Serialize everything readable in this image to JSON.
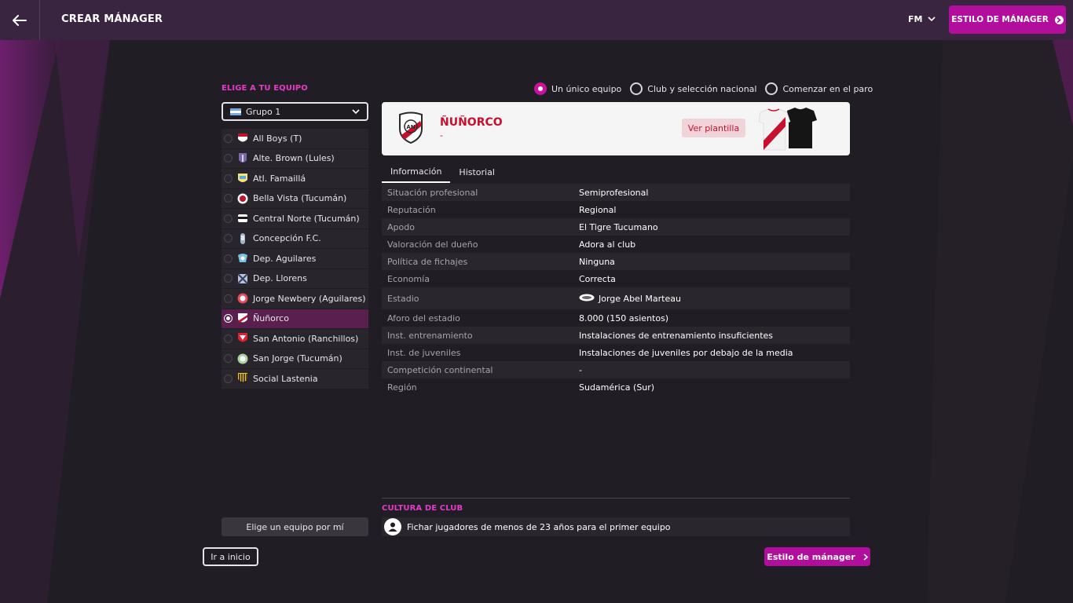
{
  "header": {
    "title": "CREAR MÁNAGER",
    "menu_label": "FM",
    "cta_label": "ESTILO DE MÁNAGER"
  },
  "team_picker": {
    "heading": "ELIGE A TU EQUIPO",
    "group_select": {
      "value": "Grupo 1",
      "flag": "argentina-flag-icon"
    },
    "teams": [
      {
        "name": "All Boys (T)",
        "icon": "all-boys-crest-icon",
        "selected": false
      },
      {
        "name": "Alte. Brown (Lules)",
        "icon": "alte-brown-crest-icon",
        "selected": false
      },
      {
        "name": "Atl. Famaillá",
        "icon": "atl-famailla-crest-icon",
        "selected": false
      },
      {
        "name": "Bella Vista (Tucumán)",
        "icon": "bella-vista-crest-icon",
        "selected": false
      },
      {
        "name": "Central Norte (Tucumán)",
        "icon": "central-norte-crest-icon",
        "selected": false
      },
      {
        "name": "Concepción F.C.",
        "icon": "concepcion-crest-icon",
        "selected": false
      },
      {
        "name": "Dep. Aguilares",
        "icon": "dep-aguilares-crest-icon",
        "selected": false
      },
      {
        "name": "Dep. Llorens",
        "icon": "dep-llorens-crest-icon",
        "selected": false
      },
      {
        "name": "Jorge Newbery (Aguilares)",
        "icon": "jorge-newbery-crest-icon",
        "selected": false
      },
      {
        "name": "Ñuñorco",
        "icon": "nunorco-crest-icon",
        "selected": true
      },
      {
        "name": "San Antonio (Ranchillos)",
        "icon": "san-antonio-crest-icon",
        "selected": false
      },
      {
        "name": "San Jorge (Tucumán)",
        "icon": "san-jorge-crest-icon",
        "selected": false
      },
      {
        "name": "Social Lastenia",
        "icon": "social-lastenia-crest-icon",
        "selected": false
      }
    ],
    "random_button": "Elige un equipo por mí",
    "home_button": "Ir a inicio"
  },
  "mode_options": [
    {
      "label": "Un único equipo",
      "selected": true
    },
    {
      "label": "Club y selección nacional",
      "selected": false
    },
    {
      "label": "Comenzar en el paro",
      "selected": false
    }
  ],
  "team_card": {
    "name": "ÑUÑORCO",
    "subtitle": "-",
    "squad_button": "Ver plantilla",
    "accent_color": "#c7102e"
  },
  "tabs": [
    {
      "label": "Información",
      "active": true
    },
    {
      "label": "Historial",
      "active": false
    }
  ],
  "info_rows": [
    {
      "label": "Situación profesional",
      "value": "Semiprofesional"
    },
    {
      "label": "Reputación",
      "value": "Regional"
    },
    {
      "label": "Apodo",
      "value": "El Tigre Tucumano"
    },
    {
      "label": "Valoración del dueño",
      "value": "Adora al club"
    },
    {
      "label": "Política de fichajes",
      "value": "Ninguna"
    },
    {
      "label": "Economía",
      "value": "Correcta"
    },
    {
      "label": "Estadio",
      "value": "Jorge Abel Marteau",
      "icon": "stadium-icon"
    },
    {
      "label": "Aforo del estadio",
      "value": "8.000 (150 asientos)"
    },
    {
      "label": "Inst. entrenamiento",
      "value": "Instalaciones de entrenamiento insuficientes"
    },
    {
      "label": "Inst. de juveniles",
      "value": "Instalaciones de juveniles por debajo de la media"
    },
    {
      "label": "Competición continental",
      "value": "-"
    },
    {
      "label": "Región",
      "value": "Sudamérica (Sur)"
    }
  ],
  "club_culture": {
    "heading": "CULTURA DE CLUB",
    "items": [
      {
        "text": "Fichar jugadores de menos de 23 años para el primer equipo",
        "icon": "user-icon"
      }
    ]
  },
  "continue_button": "Estilo de mánager",
  "colors": {
    "accent": "#b10e9e",
    "heading": "#e33bc7",
    "topbar": "#3a2540",
    "background": "#211d24"
  }
}
